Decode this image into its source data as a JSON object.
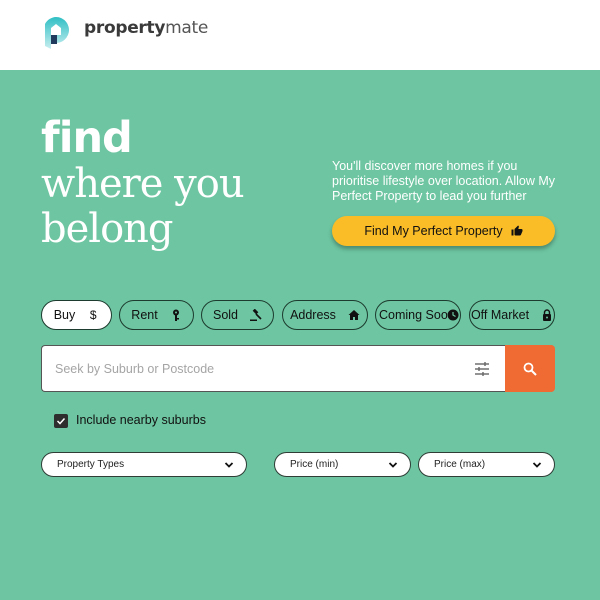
{
  "header": {
    "brand_bold": "property",
    "brand_light": "mate",
    "logo_icon": "p-house-logo-icon"
  },
  "hero": {
    "line1": "find",
    "line2": "where you",
    "line3": "belong"
  },
  "promo": {
    "text": "You'll discover more homes if you prioritise lifestyle over location. Allow My Perfect Property to lead you further",
    "cta_label": "Find My Perfect Property",
    "cta_icon": "thumbs-up-icon"
  },
  "tabs": [
    {
      "label": "Buy",
      "icon": "dollar-icon",
      "active": true
    },
    {
      "label": "Rent",
      "icon": "key-icon",
      "active": false
    },
    {
      "label": "Sold",
      "icon": "gavel-icon",
      "active": false
    },
    {
      "label": "Address",
      "icon": "home-icon",
      "active": false
    },
    {
      "label": "Coming Soon",
      "icon": "clock-icon",
      "active": false
    },
    {
      "label": "Off Market",
      "icon": "lock-icon",
      "active": false
    }
  ],
  "search": {
    "placeholder": "Seek by Suburb or Postcode",
    "value": "",
    "filter_icon": "sliders-icon",
    "button_icon": "search-icon"
  },
  "include_nearby": {
    "label": "Include nearby suburbs",
    "checked": true
  },
  "selects": {
    "property_types": "Property Types",
    "price_min": "Price (min)",
    "price_max": "Price (max)"
  },
  "colors": {
    "background": "#6dc5a1",
    "cta": "#fbbd27",
    "search_button": "#f06a33",
    "logo_teal": "#2fbfc4"
  }
}
